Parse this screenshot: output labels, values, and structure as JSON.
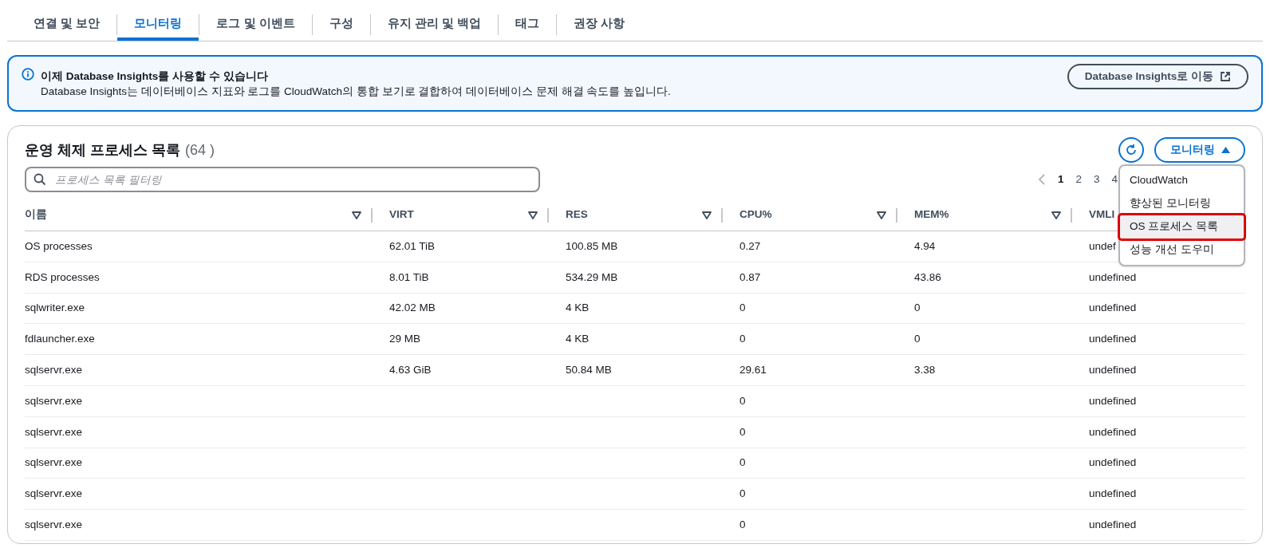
{
  "tabs": [
    {
      "label": "연결 및 보안",
      "selected": false
    },
    {
      "label": "모니터링",
      "selected": true
    },
    {
      "label": "로그 및 이벤트",
      "selected": false
    },
    {
      "label": "구성",
      "selected": false
    },
    {
      "label": "유지 관리 및 백업",
      "selected": false
    },
    {
      "label": "태그",
      "selected": false
    },
    {
      "label": "권장 사항",
      "selected": false
    }
  ],
  "banner": {
    "title": "이제 Database Insights를 사용할 수 있습니다",
    "text": "Database Insights는 데이터베이스 지표와 로그를 CloudWatch의 통합 보기로 결합하여 데이터베이스 문제 해결 속도를 높입니다.",
    "button": "Database Insights로 이동"
  },
  "panel": {
    "title": "운영 체제 프로세스 목록",
    "count": "(64 )",
    "monitoring_button": "모니터링",
    "search": {
      "placeholder": "프로세스 목록 필터링"
    },
    "pagination": [
      {
        "label": "1",
        "selected": true
      },
      {
        "label": "2",
        "selected": false
      },
      {
        "label": "3",
        "selected": false
      },
      {
        "label": "4",
        "selected": false
      }
    ],
    "menu": [
      {
        "label": "CloudWatch",
        "selected": false
      },
      {
        "label": "향상된 모니터링",
        "selected": false
      },
      {
        "label": "OS 프로세스 목록",
        "selected": true
      },
      {
        "label": "성능 개선 도우미",
        "selected": false
      }
    ],
    "table": {
      "columns": [
        {
          "label": "이름",
          "sortable": true
        },
        {
          "label": "VIRT",
          "sortable": true
        },
        {
          "label": "RES",
          "sortable": true
        },
        {
          "label": "CPU%",
          "sortable": true
        },
        {
          "label": "MEM%",
          "sortable": true
        },
        {
          "label": "VMLI",
          "sortable": false
        }
      ],
      "rows": [
        [
          "OS processes",
          "62.01 TiB",
          "100.85 MB",
          "0.27",
          "4.94",
          "undef"
        ],
        [
          "RDS processes",
          "8.01 TiB",
          "534.29 MB",
          "0.87",
          "43.86",
          "undefined"
        ],
        [
          "sqlwriter.exe",
          "42.02 MB",
          "4 KB",
          "0",
          "0",
          "undefined"
        ],
        [
          "fdlauncher.exe",
          "29 MB",
          "4 KB",
          "0",
          "0",
          "undefined"
        ],
        [
          "sqlservr.exe",
          "4.63 GiB",
          "50.84 MB",
          "29.61",
          "3.38",
          "undefined"
        ],
        [
          "sqlservr.exe",
          "",
          "",
          "0",
          "",
          "undefined"
        ],
        [
          "sqlservr.exe",
          "",
          "",
          "0",
          "",
          "undefined"
        ],
        [
          "sqlservr.exe",
          "",
          "",
          "0",
          "",
          "undefined"
        ],
        [
          "sqlservr.exe",
          "",
          "",
          "0",
          "",
          "undefined"
        ],
        [
          "sqlservr.exe",
          "",
          "",
          "0",
          "",
          "undefined"
        ]
      ]
    }
  }
}
